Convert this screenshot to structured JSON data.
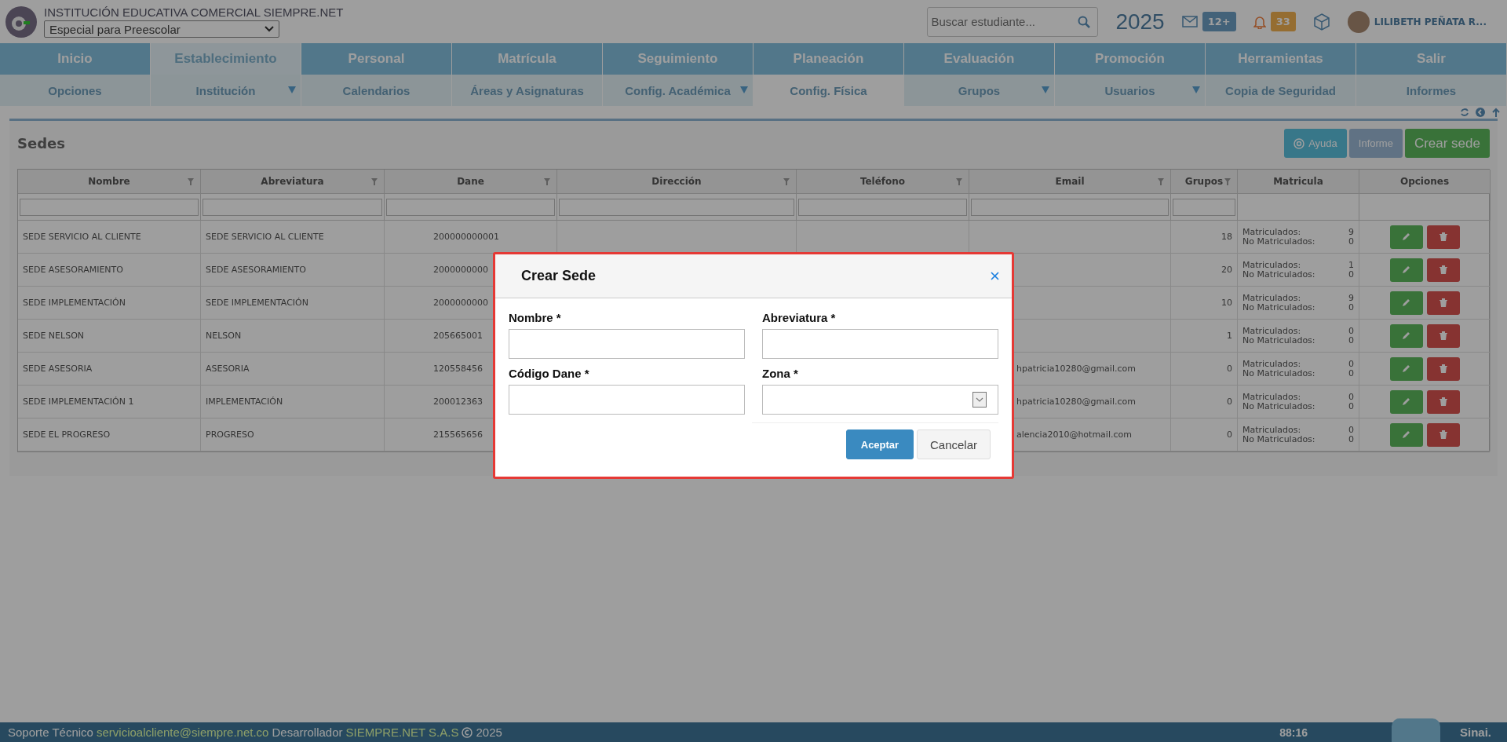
{
  "header": {
    "institution": "INSTITUCIÓN EDUCATIVA COMERCIAL SIEMPRE.NET",
    "program_select": "Especial para Preescolar",
    "search": {
      "placeholder": "Buscar estudiante..."
    },
    "year": "2025",
    "messages_badge": "12+",
    "alerts_badge": "33",
    "user_name": "LILIBETH PEÑATA R..."
  },
  "main_menu": [
    {
      "label": "Inicio",
      "selected": false
    },
    {
      "label": "Establecimiento",
      "selected": true
    },
    {
      "label": "Personal",
      "selected": false
    },
    {
      "label": "Matrícula",
      "selected": false
    },
    {
      "label": "Seguimiento",
      "selected": false
    },
    {
      "label": "Planeación",
      "selected": false
    },
    {
      "label": "Evaluación",
      "selected": false
    },
    {
      "label": "Promoción",
      "selected": false
    },
    {
      "label": "Herramientas",
      "selected": false
    },
    {
      "label": "Salir",
      "selected": false
    }
  ],
  "sub_menu": [
    {
      "label": "Opciones",
      "selected": false,
      "has_dropdown": false
    },
    {
      "label": "Institución",
      "selected": false,
      "has_dropdown": true
    },
    {
      "label": "Calendarios",
      "selected": false,
      "has_dropdown": false
    },
    {
      "label": "Áreas y Asignaturas",
      "selected": false,
      "has_dropdown": false
    },
    {
      "label": "Config. Académica",
      "selected": false,
      "has_dropdown": true
    },
    {
      "label": "Config. Física",
      "selected": true,
      "has_dropdown": false
    },
    {
      "label": "Grupos",
      "selected": false,
      "has_dropdown": true
    },
    {
      "label": "Usuarios",
      "selected": false,
      "has_dropdown": true
    },
    {
      "label": "Copia de Seguridad",
      "selected": false,
      "has_dropdown": false
    },
    {
      "label": "Informes",
      "selected": false,
      "has_dropdown": false
    }
  ],
  "panel": {
    "title": "Sedes",
    "buttons": [
      {
        "label": "Ayuda",
        "kind": "help"
      },
      {
        "label": "Informe",
        "kind": "report"
      },
      {
        "label": "Crear sede",
        "kind": "create"
      }
    ]
  },
  "table": {
    "columns": [
      {
        "label": "Nombre",
        "filter": true
      },
      {
        "label": "Abreviatura",
        "filter": true
      },
      {
        "label": "Dane",
        "filter": true
      },
      {
        "label": "Dirección",
        "filter": true
      },
      {
        "label": "Teléfono",
        "filter": true
      },
      {
        "label": "Email",
        "filter": true
      },
      {
        "label": "Grupos",
        "filter": true
      },
      {
        "label": "Matricula",
        "filter": false
      },
      {
        "label": "Opciones",
        "filter": false
      }
    ],
    "rows": [
      {
        "nombre": "SEDE SERVICIO AL CLIENTE",
        "abreviatura": "SEDE SERVICIO AL CLIENTE",
        "dane": "200000000001",
        "grupos": "18",
        "matricula": [
          {
            "label": "Matriculados:",
            "value": "9"
          },
          {
            "label": "No Matriculados:",
            "value": "0"
          }
        ]
      },
      {
        "nombre": "SEDE ASESORAMIENTO",
        "abreviatura": "SEDE ASESORAMIENTO",
        "dane": "2000000000",
        "grupos": "20",
        "matricula": [
          {
            "label": "Matriculados:",
            "value": "1"
          },
          {
            "label": "No Matriculados:",
            "value": "0"
          }
        ]
      },
      {
        "nombre": "SEDE IMPLEMENTACIÓN",
        "abreviatura": "SEDE IMPLEMENTACIÓN",
        "dane": "2000000000",
        "grupos": "10",
        "matricula": [
          {
            "label": "Matriculados:",
            "value": "9"
          },
          {
            "label": "No Matriculados:",
            "value": "0"
          }
        ]
      },
      {
        "nombre": "SEDE NELSON",
        "abreviatura": "NELSON",
        "dane": "205665001",
        "grupos": "1",
        "matricula": [
          {
            "label": "Matriculados:",
            "value": "0"
          },
          {
            "label": "No Matriculados:",
            "value": "0"
          }
        ]
      },
      {
        "nombre": "SEDE ASESORIA",
        "abreviatura": "ASESORIA",
        "dane": "120558456",
        "email": "hpatricia10280@gmail.com",
        "grupos": "0",
        "matricula": [
          {
            "label": "Matriculados:",
            "value": "0"
          },
          {
            "label": "No Matriculados:",
            "value": "0"
          }
        ]
      },
      {
        "nombre": "SEDE IMPLEMENTACIÓN 1",
        "abreviatura": "IMPLEMENTACIÓN",
        "dane": "200012363",
        "email": "hpatricia10280@gmail.com",
        "grupos": "0",
        "matricula": [
          {
            "label": "Matriculados:",
            "value": "0"
          },
          {
            "label": "No Matriculados:",
            "value": "0"
          }
        ]
      },
      {
        "nombre": "SEDE EL PROGRESO",
        "abreviatura": "PROGRESO",
        "dane": "215565656",
        "email": "alencia2010@hotmail.com",
        "grupos": "0",
        "matricula": [
          {
            "label": "Matriculados:",
            "value": "0"
          },
          {
            "label": "No Matriculados:",
            "value": "0"
          }
        ]
      }
    ]
  },
  "modal": {
    "title": "Crear Sede",
    "fields": [
      {
        "label": "Nombre *",
        "kind": "text"
      },
      {
        "label": "Abreviatura *",
        "kind": "text"
      },
      {
        "label": "Código Dane *",
        "kind": "text"
      },
      {
        "label": "Zona *",
        "kind": "select"
      }
    ],
    "buttons": [
      {
        "label": "Aceptar",
        "kind": "primary"
      },
      {
        "label": "Cancelar",
        "kind": "secondary"
      }
    ]
  },
  "footer": {
    "support_label": "Soporte Técnico",
    "support_email": "servicioalcliente@siempre.net.co",
    "developer_label": "Desarrollador",
    "developer": "SIEMPRE.NET S.A.S",
    "copyright": "2025",
    "timer": "88:16",
    "brand": "Sinai."
  }
}
